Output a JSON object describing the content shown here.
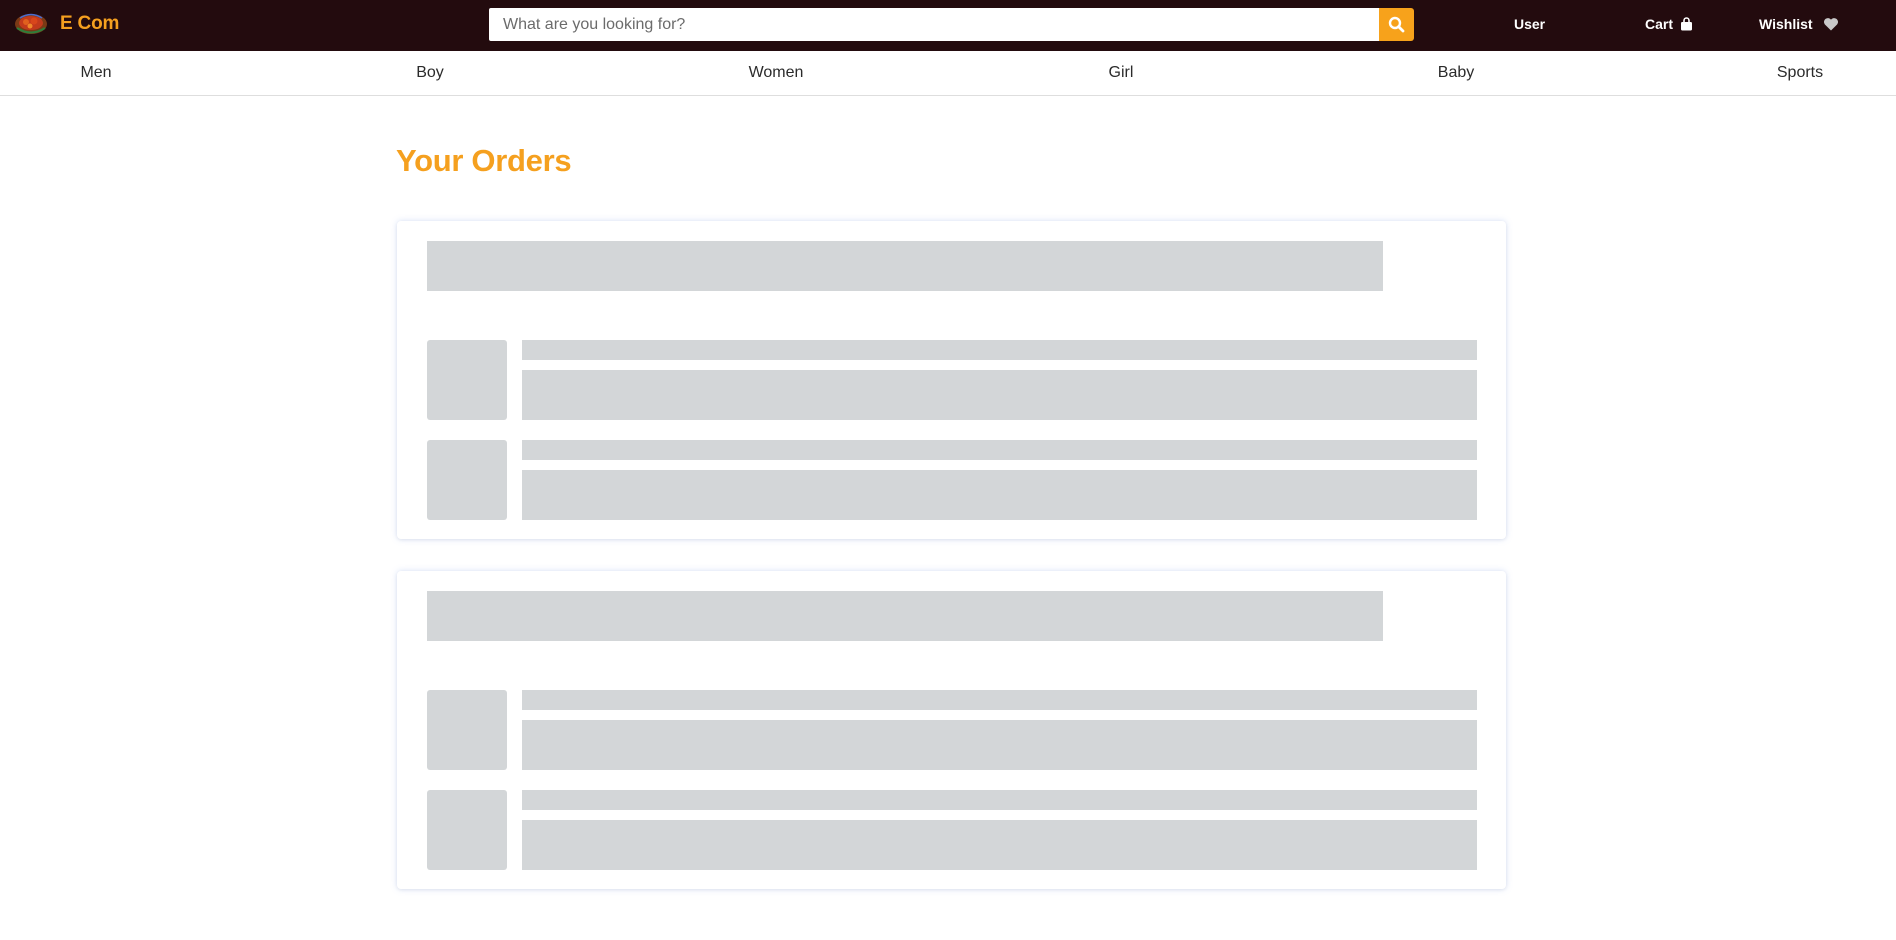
{
  "header": {
    "brand_name": "E Com",
    "search": {
      "placeholder": "What are you looking for?",
      "value": ""
    },
    "links": {
      "user": "User",
      "cart": "Cart",
      "wishlist": "Wishlist"
    },
    "icons": {
      "logo": "ecom-logo",
      "search": "search-icon",
      "cart": "shopping-bag-icon",
      "wishlist": "heart-icon"
    }
  },
  "categories": [
    "Men",
    "Boy",
    "Women",
    "Girl",
    "Baby",
    "Sports"
  ],
  "main": {
    "title": "Your Orders",
    "order_cards_loading": 2,
    "items_per_card_loading": 2
  },
  "colors": {
    "topbar": "#230b0e",
    "accent": "#f5a01f",
    "skeleton": "#d3d6d8"
  }
}
